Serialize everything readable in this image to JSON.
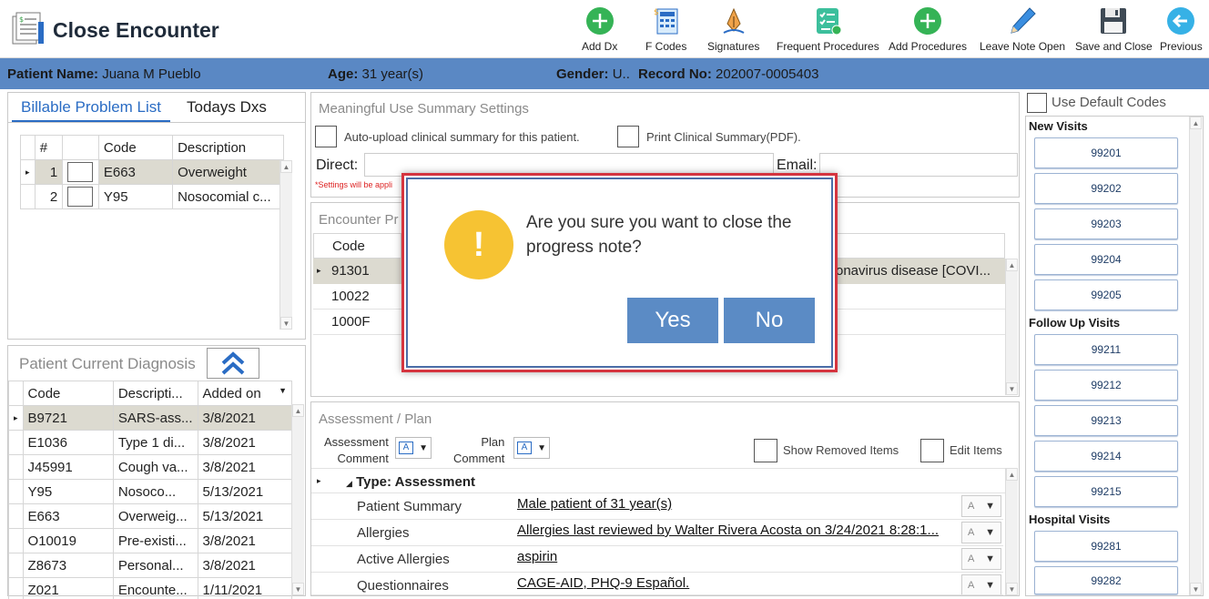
{
  "window": {
    "title": "Close Encounter"
  },
  "toolbar": {
    "add_dx": "Add Dx",
    "f_codes": "F Codes",
    "signatures": "Signatures",
    "frequent_procedures": "Frequent Procedures",
    "add_procedures": "Add Procedures",
    "leave_note_open": "Leave Note Open",
    "save_and_close": "Save and Close",
    "previous": "Previous"
  },
  "patient": {
    "name_label": "Patient Name:",
    "name": "Juana M Pueblo",
    "age_label": "Age:",
    "age": "31 year(s)",
    "gender_label": "Gender:",
    "gender": "U..",
    "record_label": "Record No:",
    "record": "202007-0005403"
  },
  "billable": {
    "tabs": [
      "Billable Problem List",
      "Todays Dxs"
    ],
    "columns": [
      "#",
      "",
      "Code",
      "Description"
    ],
    "rows": [
      {
        "num": "1",
        "code": "E663",
        "desc": "Overweight"
      },
      {
        "num": "2",
        "code": "Y95",
        "desc": "Nosocomial c..."
      }
    ]
  },
  "current_dx": {
    "title": "Patient Current Diagnosis",
    "columns": [
      "Code",
      "Descripti...",
      "Added on"
    ],
    "rows": [
      {
        "code": "B9721",
        "desc": "SARS-ass...",
        "added": "3/8/2021"
      },
      {
        "code": "E1036",
        "desc": "Type 1 di...",
        "added": "3/8/2021"
      },
      {
        "code": "J45991",
        "desc": "Cough va...",
        "added": "3/8/2021"
      },
      {
        "code": "Y95",
        "desc": "Nosoco...",
        "added": "5/13/2021"
      },
      {
        "code": "E663",
        "desc": "Overweig...",
        "added": "5/13/2021"
      },
      {
        "code": "O10019",
        "desc": "Pre-existi...",
        "added": "3/8/2021"
      },
      {
        "code": "Z8673",
        "desc": "Personal...",
        "added": "3/8/2021"
      },
      {
        "code": "Z021",
        "desc": "Encounte...",
        "added": "1/11/2021"
      }
    ]
  },
  "mu": {
    "title": "Meaningful Use Summary Settings",
    "auto_upload": "Auto-upload clinical summary for this patient.",
    "print_summary": "Print Clinical Summary(PDF).",
    "direct_label": "Direct:",
    "email_label": "Email:",
    "note": "*Settings will be appli"
  },
  "encounter": {
    "title": "Encounter Pr",
    "code_header": "Code",
    "codes": [
      "91301",
      "10022",
      "1000F"
    ],
    "desc_first": "onavirus disease [COVI..."
  },
  "assessment": {
    "title": "Assessment / Plan",
    "assessment_comment_l1": "Assessment",
    "assessment_comment_l2": "Comment",
    "plan_comment_l1": "Plan",
    "plan_comment_l2": "Comment",
    "show_removed": "Show Removed Items",
    "edit_items": "Edit Items",
    "type_header": "Type: Assessment",
    "rows": [
      {
        "label": "Patient Summary",
        "value": "Male patient of 31 year(s)"
      },
      {
        "label": "Allergies",
        "value": "Allergies last reviewed by Walter Rivera Acosta on 3/24/2021 8:28:1..."
      },
      {
        "label": "Active Allergies",
        "value": "aspirin"
      },
      {
        "label": "Questionnaires",
        "value": "CAGE-AID, PHQ-9 Español."
      }
    ]
  },
  "billing_codes": {
    "use_default": "Use Default Codes",
    "new_visits_label": "New Visits",
    "new_visits": [
      "99201",
      "99202",
      "99203",
      "99204",
      "99205"
    ],
    "follow_up_label": "Follow Up Visits",
    "follow_up": [
      "99211",
      "99212",
      "99213",
      "99214",
      "99215"
    ],
    "hospital_label": "Hospital Visits",
    "hospital": [
      "99281",
      "99282"
    ]
  },
  "dialog": {
    "message": "Are you sure you want to close the progress note?",
    "yes": "Yes",
    "no": "No",
    "icon": "!"
  },
  "colors": {
    "accent": "#2a6cc4",
    "patient_bar": "#5a88c4",
    "dialog_button": "#5b8bc5",
    "warning": "#f6c333",
    "dialog_border": "#d5343f",
    "green": "#35b356"
  }
}
